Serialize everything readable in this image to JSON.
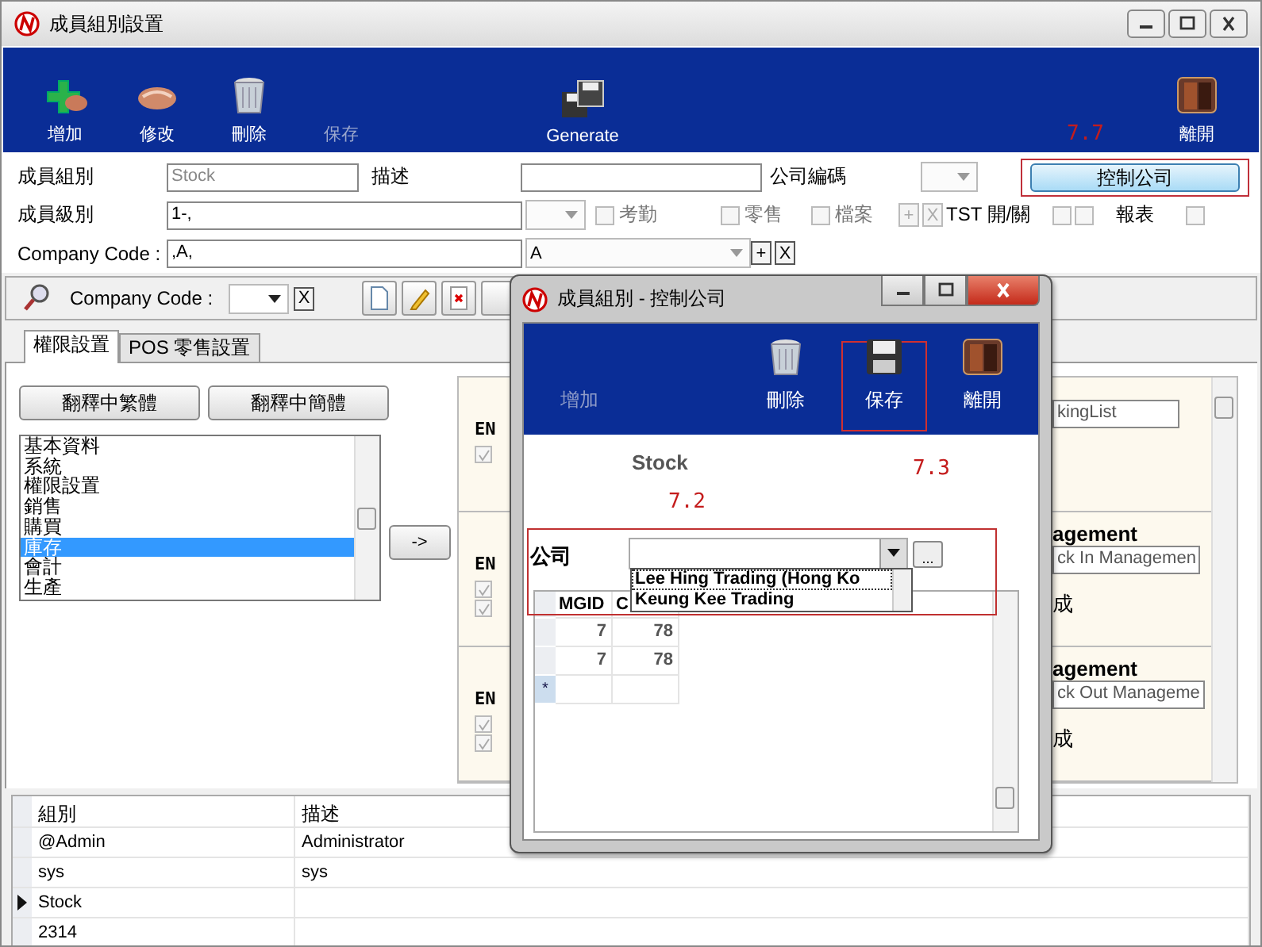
{
  "window": {
    "title": "成員組別設置"
  },
  "toolbar": [
    {
      "kind": "add",
      "label": "增加",
      "disabled": false
    },
    {
      "kind": "edit",
      "label": "修改",
      "disabled": false
    },
    {
      "kind": "delete",
      "label": "刪除",
      "disabled": false
    },
    {
      "kind": "save",
      "label": "保存",
      "disabled": true
    },
    {
      "kind": "generate",
      "label": "Generate",
      "disabled": false
    },
    {
      "kind": "exit",
      "label": "離開",
      "disabled": false
    }
  ],
  "form": {
    "group_label": "成員組別",
    "group_value": "Stock",
    "description_label": "描述",
    "company_no_label": "公司編碼",
    "control_button": {
      "label": "控制公司",
      "highlighted": true,
      "callout": "7.7"
    },
    "level_label": "成員級別",
    "level_value": "1-,",
    "checkboxes": [
      {
        "label": "考勤",
        "checked": false
      },
      {
        "label": "零售",
        "checked": false
      },
      {
        "label": "檔案",
        "checked": false
      }
    ],
    "plus_button": "+",
    "clear_button": "X",
    "tst_label": "TST 開/關",
    "tst_checks": [
      {
        "checked": false
      },
      {
        "checked": false
      }
    ],
    "report_label": "報表",
    "report_check": {
      "checked": false
    },
    "company_code_label": "Company Code :",
    "company_code_value": ",A,",
    "company_code_select": "A",
    "company_plus_button": "+",
    "company_clear_button": "X"
  },
  "filter": {
    "label": "Company Code :",
    "clear_button": "X"
  },
  "tabs": [
    {
      "label": "權限設置",
      "selected": true
    },
    {
      "label": "POS 零售設置",
      "selected": false
    }
  ],
  "translate_buttons": [
    "翻釋中繁體",
    "翻釋中簡體"
  ],
  "modules": [
    {
      "label": "基本資料",
      "selected": false
    },
    {
      "label": "系統",
      "selected": false
    },
    {
      "label": "權限設置",
      "selected": false
    },
    {
      "label": "銷售",
      "selected": false
    },
    {
      "label": "購買",
      "selected": false
    },
    {
      "label": "庫存",
      "selected": true
    },
    {
      "label": "會計",
      "selected": false
    },
    {
      "label": "生產",
      "selected": false
    }
  ],
  "move_button": "->",
  "sections": [
    {
      "tag": "EN",
      "checks": [
        {
          "checked": true
        }
      ],
      "field": "kingList"
    },
    {
      "tag": "EN",
      "checks": [
        {
          "checked": true
        },
        {
          "checked": true
        }
      ],
      "heading": "agement",
      "field": "ck In Managemen",
      "note": "成"
    },
    {
      "tag": "EN",
      "checks": [
        {
          "checked": true
        },
        {
          "checked": true
        }
      ],
      "heading": "agement",
      "field": "ck Out Manageme",
      "note": "成"
    }
  ],
  "groups": {
    "columns": [
      "組別",
      "描述"
    ],
    "rows": [
      {
        "cells": [
          "@Admin",
          "Administrator"
        ],
        "selected": false
      },
      {
        "cells": [
          "sys",
          "sys"
        ],
        "selected": false
      },
      {
        "cells": [
          "Stock",
          ""
        ],
        "selected": true
      },
      {
        "cells": [
          "2314",
          ""
        ],
        "selected": false
      }
    ]
  },
  "dialog": {
    "title": "成員組別 - 控制公司",
    "toolbar": [
      {
        "kind": "add",
        "label": "增加",
        "disabled": true,
        "highlighted": false
      },
      {
        "kind": "delete",
        "label": "刪除",
        "disabled": false,
        "highlighted": false
      },
      {
        "kind": "save",
        "label": "保存",
        "disabled": false,
        "highlighted": true,
        "callout": "7.3"
      },
      {
        "kind": "exit",
        "label": "離開",
        "disabled": false,
        "highlighted": false
      }
    ],
    "group": "Stock",
    "company": {
      "label": "公司",
      "highlighted": true,
      "callout": "7.2",
      "browse_button": "...",
      "options": [
        "Lee Hing Trading (Hong Ko",
        "Keung Kee Trading"
      ]
    },
    "grid": {
      "columns": [
        "MGID",
        "C"
      ],
      "rows": [
        [
          "7",
          "78"
        ],
        [
          "7",
          "78"
        ]
      ],
      "new_row_marker": "*"
    }
  }
}
